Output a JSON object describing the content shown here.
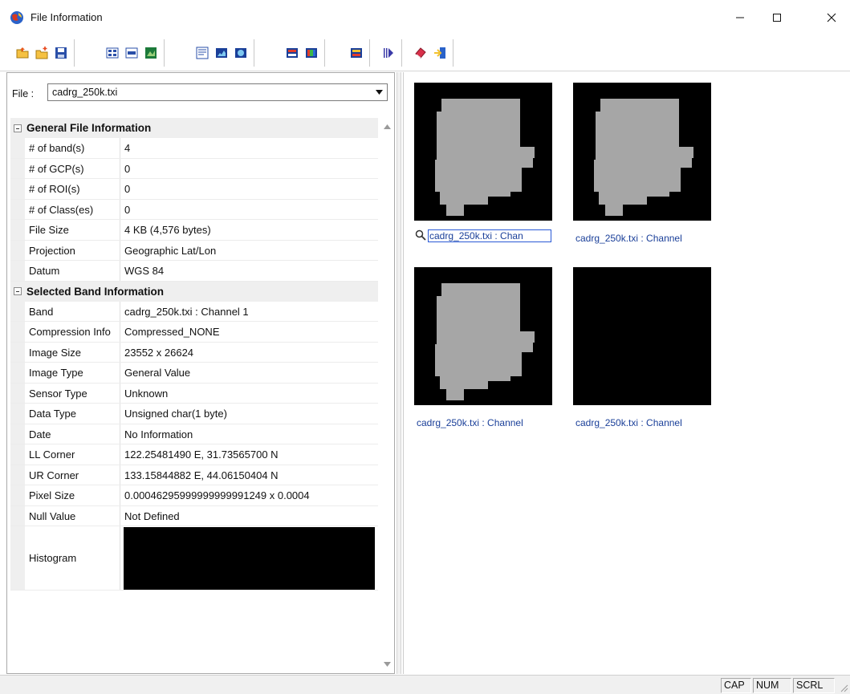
{
  "window": {
    "title": "File Information",
    "minimize_glyph": "—",
    "maximize_glyph": "☐",
    "close_glyph": "✕"
  },
  "toolbar": {
    "groups": [
      [
        "open-folder-icon",
        "new-folder-icon",
        "save-icon"
      ],
      [
        "grid-view-icon",
        "band-view-icon",
        "image-view-icon"
      ],
      [
        "statistics-icon",
        "histogram-icon",
        "image-layer-icon"
      ],
      [
        "display-icon",
        "color-bands-icon"
      ],
      [
        "palette-icon"
      ],
      [
        "play-icon"
      ],
      [
        "help-book-icon",
        "exit-icon"
      ]
    ]
  },
  "file": {
    "label": "File :",
    "selected": "cadrg_250k.txi"
  },
  "sections": [
    {
      "title": "General File Information",
      "rows": [
        {
          "name": "# of band(s)",
          "value": "4"
        },
        {
          "name": "# of GCP(s)",
          "value": "0"
        },
        {
          "name": "# of ROI(s)",
          "value": "0"
        },
        {
          "name": "# of Class(es)",
          "value": "0"
        },
        {
          "name": "File Size",
          "value": "4 KB (4,576 bytes)"
        },
        {
          "name": "Projection",
          "value": "Geographic Lat/Lon"
        },
        {
          "name": "Datum",
          "value": "WGS 84"
        }
      ]
    },
    {
      "title": "Selected Band Information",
      "rows": [
        {
          "name": "Band",
          "value": "cadrg_250k.txi : Channel 1"
        },
        {
          "name": "Compression Info",
          "value": "Compressed_NONE"
        },
        {
          "name": "Image Size",
          "value": "23552 x 26624"
        },
        {
          "name": "Image Type",
          "value": "General Value"
        },
        {
          "name": "Sensor Type",
          "value": "Unknown"
        },
        {
          "name": "Data Type",
          "value": "Unsigned char(1 byte)"
        },
        {
          "name": "Date",
          "value": "No Information"
        },
        {
          "name": "LL Corner",
          "value": "122.25481490 E, 31.73565700 N"
        },
        {
          "name": "UR Corner",
          "value": "133.15844882 E, 44.06150404 N"
        },
        {
          "name": "Pixel Size",
          "value": "0.00046295999999999991249 x 0.0004"
        },
        {
          "name": "Null Value",
          "value": "Not Defined"
        }
      ],
      "histogram_label": "Histogram"
    }
  ],
  "thumbnails": [
    {
      "caption": "cadrg_250k.txi : Chan",
      "selected": true,
      "has_shape": true
    },
    {
      "caption": "cadrg_250k.txi : Channel",
      "selected": false,
      "has_shape": true
    },
    {
      "caption": "cadrg_250k.txi : Channel",
      "selected": false,
      "has_shape": true
    },
    {
      "caption": "cadrg_250k.txi : Channel",
      "selected": false,
      "has_shape": false
    }
  ],
  "status": {
    "cap": "CAP",
    "num": "NUM",
    "scrl": "SCRL"
  },
  "colors": {
    "accent": "#1a3f99",
    "thumb_bg": "#000000",
    "thumb_shape": "#a6a6a6"
  }
}
